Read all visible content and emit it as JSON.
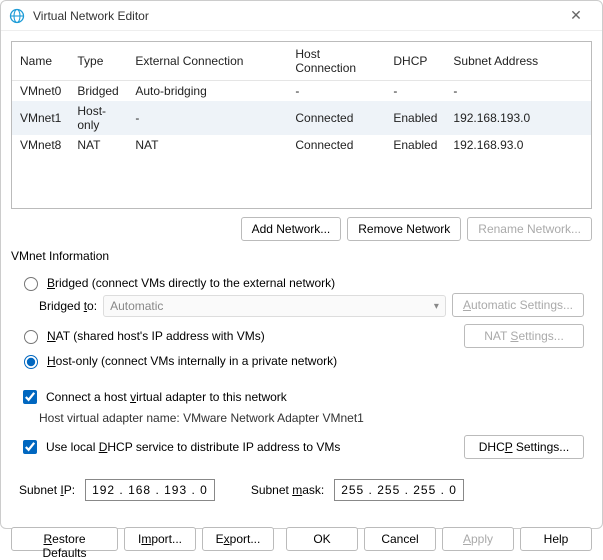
{
  "window": {
    "title": "Virtual Network Editor",
    "close_glyph": "✕"
  },
  "columns": {
    "name": "Name",
    "type": "Type",
    "ext": "External Connection",
    "host": "Host Connection",
    "dhcp": "DHCP",
    "sub": "Subnet Address"
  },
  "rows": [
    {
      "name": "VMnet0",
      "type": "Bridged",
      "ext": "Auto-bridging",
      "host": "-",
      "dhcp": "-",
      "sub": "-"
    },
    {
      "name": "VMnet1",
      "type": "Host-only",
      "ext": "-",
      "host": "Connected",
      "dhcp": "Enabled",
      "sub": "192.168.193.0"
    },
    {
      "name": "VMnet8",
      "type": "NAT",
      "ext": "NAT",
      "host": "Connected",
      "dhcp": "Enabled",
      "sub": "192.168.93.0"
    }
  ],
  "selected_row": 1,
  "buttons": {
    "add": "Add Network...",
    "remove": "Remove Network",
    "rename": "Rename Network..."
  },
  "info": {
    "heading": "VMnet Information",
    "bridged_label": "Bridged (connect VMs directly to the external network)",
    "bridged_to_label": "Bridged to:",
    "bridged_to_value": "Automatic",
    "auto_settings": "Automatic Settings...",
    "nat_label": "NAT (shared host's IP address with VMs)",
    "nat_settings": "NAT Settings...",
    "hostonly_label": "Host-only (connect VMs internally in a private network)",
    "connect_adapter": "Connect a host virtual adapter to this network",
    "adapter_name_label": "Host virtual adapter name:",
    "adapter_name_value": "VMware Network Adapter VMnet1",
    "use_dhcp": "Use local DHCP service to distribute IP address to VMs",
    "dhcp_settings": "DHCP Settings...",
    "subnet_ip_label": "Subnet IP:",
    "subnet_ip_value": "192 . 168 . 193 .  0",
    "subnet_mask_label": "Subnet mask:",
    "subnet_mask_value": "255 . 255 . 255 .  0"
  },
  "footer": {
    "restore": "Restore Defaults",
    "import": "Import...",
    "export": "Export...",
    "ok": "OK",
    "cancel": "Cancel",
    "apply": "Apply",
    "help": "Help"
  }
}
